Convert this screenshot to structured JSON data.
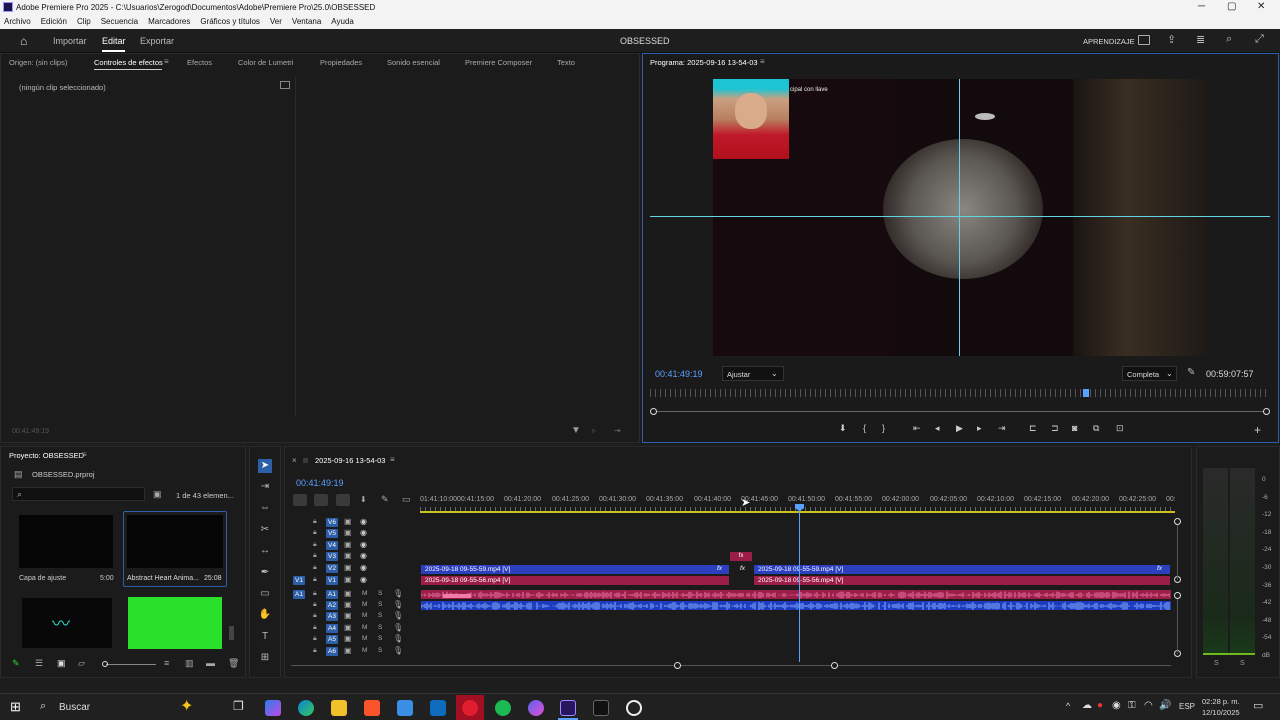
{
  "window": {
    "title": "Adobe Premiere Pro 2025 - C:\\Usuarios\\Zerogod\\Documentos\\Adobe\\Premiere Pro\\25.0\\OBSESSED",
    "minimize": "─",
    "maximize": "▢",
    "close": "✕"
  },
  "menu": [
    "Archivo",
    "Edición",
    "Clip",
    "Secuencia",
    "Marcadores",
    "Gráficos y títulos",
    "Ver",
    "Ventana",
    "Ayuda"
  ],
  "header": {
    "nav": [
      "Importar",
      "Editar",
      "Exportar"
    ],
    "project_title": "OBSESSED",
    "learn": "APRENDIZAJE"
  },
  "source_panel": {
    "tabs": [
      "Origen: (sin clips)",
      "Controles de efectos",
      "Efectos",
      "Color de Lumetri",
      "Propiedades",
      "Sonido esencial",
      "Premiere Composer",
      "Texto"
    ],
    "empty_text": "(ningún clip seleccionado)",
    "timecode": "00:41:49:19"
  },
  "program_monitor": {
    "title": "Programa: 2025-09-16 13-54-03",
    "overlay_text": "cipal con llave",
    "timecode": "00:41:49:19",
    "fit": "Ajustar",
    "quality": "Completa",
    "duration": "00:59:07:57"
  },
  "project_panel": {
    "title": "Proyecto: OBSESSED",
    "file": "OBSESSED.prproj",
    "count": "1 de 43 elemen...",
    "items": [
      {
        "name": "Capa de ajuste",
        "duration": "5:00"
      },
      {
        "name": "Abstract Heart Anima...",
        "duration": "25:08"
      }
    ]
  },
  "timeline": {
    "sequence": "2025-09-16 13-54-03",
    "timecode": "00:41:49:19",
    "ruler": [
      "01:41:10:00",
      "00:41:15:00",
      "00:41:20:00",
      "00:41:25:00",
      "00:41:30:00",
      "00:41:35:00",
      "00:41:40:00",
      "00:41:45:00",
      "00:41:50:00",
      "00:41:55:00",
      "00:42:00:00",
      "00:42:05:00",
      "00:42:10:00",
      "00:42:15:00",
      "00:42:20:00",
      "00:42:25:00",
      "00:"
    ],
    "video_tracks": [
      "V6",
      "V5",
      "V4",
      "V3",
      "V2",
      "V1"
    ],
    "audio_tracks": [
      "A1",
      "A2",
      "A3",
      "A4",
      "A5",
      "A6"
    ],
    "clips": {
      "v2_a": "2025-09-18 09-55-59.mp4 [V]",
      "v1_a": "2025-09-18 09-55-56.mp4 [V]",
      "v2_b": "2025-09-18 09-55-59.mp4 [V]",
      "v1_b": "2025-09-18 09-55-56.mp4 [V]",
      "fx": "fx"
    },
    "src_patch_v": "V1",
    "src_patch_a": "A1"
  },
  "meter_scale": [
    "0",
    "-6",
    "-12",
    "-18",
    "-24",
    "-30",
    "-36",
    "-42",
    "-48",
    "-54",
    "dB"
  ],
  "meter_solo": [
    "S",
    "S"
  ],
  "taskbar": {
    "search": "Buscar",
    "lang": "ESP",
    "time": "02:28 p. m.",
    "date": "12/10/2025"
  },
  "colors": {
    "accent": "#2c5fa8",
    "video_clip": "#2b3fbf",
    "audio_clip": "#9a1e48",
    "playhead": "#5aa0ff"
  }
}
